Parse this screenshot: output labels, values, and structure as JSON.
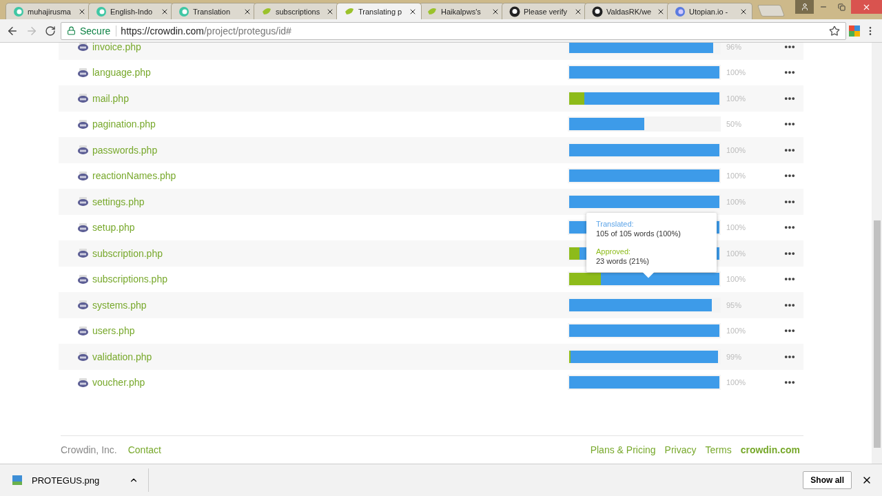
{
  "browser": {
    "tabs": [
      {
        "title": "muhajirusma",
        "selected": false
      },
      {
        "title": "English-Indo",
        "selected": false
      },
      {
        "title": "Translation",
        "selected": false
      },
      {
        "title": "subscriptions",
        "selected": false
      },
      {
        "title": "Translating p",
        "selected": true
      },
      {
        "title": "Haikalpws's",
        "selected": false
      },
      {
        "title": "Please verify",
        "selected": false
      },
      {
        "title": "ValdasRK/we",
        "selected": false
      },
      {
        "title": "Utopian.io -",
        "selected": false
      }
    ],
    "address": {
      "secure_label": "Secure",
      "host": "https://crowdin.com",
      "path": "/project/protegus/id#"
    }
  },
  "files": [
    {
      "name": "invoice.php",
      "translated": {
        "level": 0.96
      },
      "percent": "96%"
    },
    {
      "name": "language.php",
      "translated": {
        "level": 1
      },
      "percent": "100%"
    },
    {
      "name": "mail.php",
      "translated": {
        "level": 1
      },
      "approved": {
        "level": 0.1
      },
      "percent": "100%"
    },
    {
      "name": "pagination.php",
      "translated": {
        "level": 0.5
      },
      "percent": "50%"
    },
    {
      "name": "passwords.php",
      "translated": {
        "level": 1
      },
      "percent": "100%"
    },
    {
      "name": "reactionNames.php",
      "translated": {
        "level": 1
      },
      "percent": "100%"
    },
    {
      "name": "settings.php",
      "translated": {
        "level": 1
      },
      "percent": "100%"
    },
    {
      "name": "setup.php",
      "translated": {
        "level": 1
      },
      "percent": "100%"
    },
    {
      "name": "subscription.php",
      "translated": {
        "level": 1
      },
      "approved": {
        "level": 0.07
      },
      "percent": "100%"
    },
    {
      "name": "subscriptions.php",
      "translated": {
        "level": 1
      },
      "approved": {
        "level": 0.21
      },
      "percent": "100%"
    },
    {
      "name": "systems.php",
      "translated": {
        "level": 0.95
      },
      "percent": "95%"
    },
    {
      "name": "users.php",
      "translated": {
        "level": 1
      },
      "percent": "100%"
    },
    {
      "name": "validation.php",
      "translated": {
        "level": 0.99
      },
      "approved": {
        "level": 0.01
      },
      "percent": "99%"
    },
    {
      "name": "voucher.php",
      "translated": {
        "level": 1
      },
      "percent": "100%"
    }
  ],
  "tooltip": {
    "translated_label": "Translated:",
    "translated_value": "105 of 105 words (100%)",
    "approved_label": "Approved:",
    "approved_value": "23 words (21%)"
  },
  "footer": {
    "left": [
      {
        "text": "Crowdin, Inc.",
        "kind": "plain"
      },
      {
        "text": "Contact",
        "kind": "link"
      }
    ],
    "right": [
      {
        "text": "Plans & Pricing",
        "kind": "link"
      },
      {
        "text": "Privacy",
        "kind": "link"
      },
      {
        "text": "Terms",
        "kind": "link"
      },
      {
        "text": "crowdin.com",
        "kind": "brand"
      }
    ]
  },
  "downloads": {
    "file": "PROTEGUS.png",
    "show_all": "Show all"
  }
}
